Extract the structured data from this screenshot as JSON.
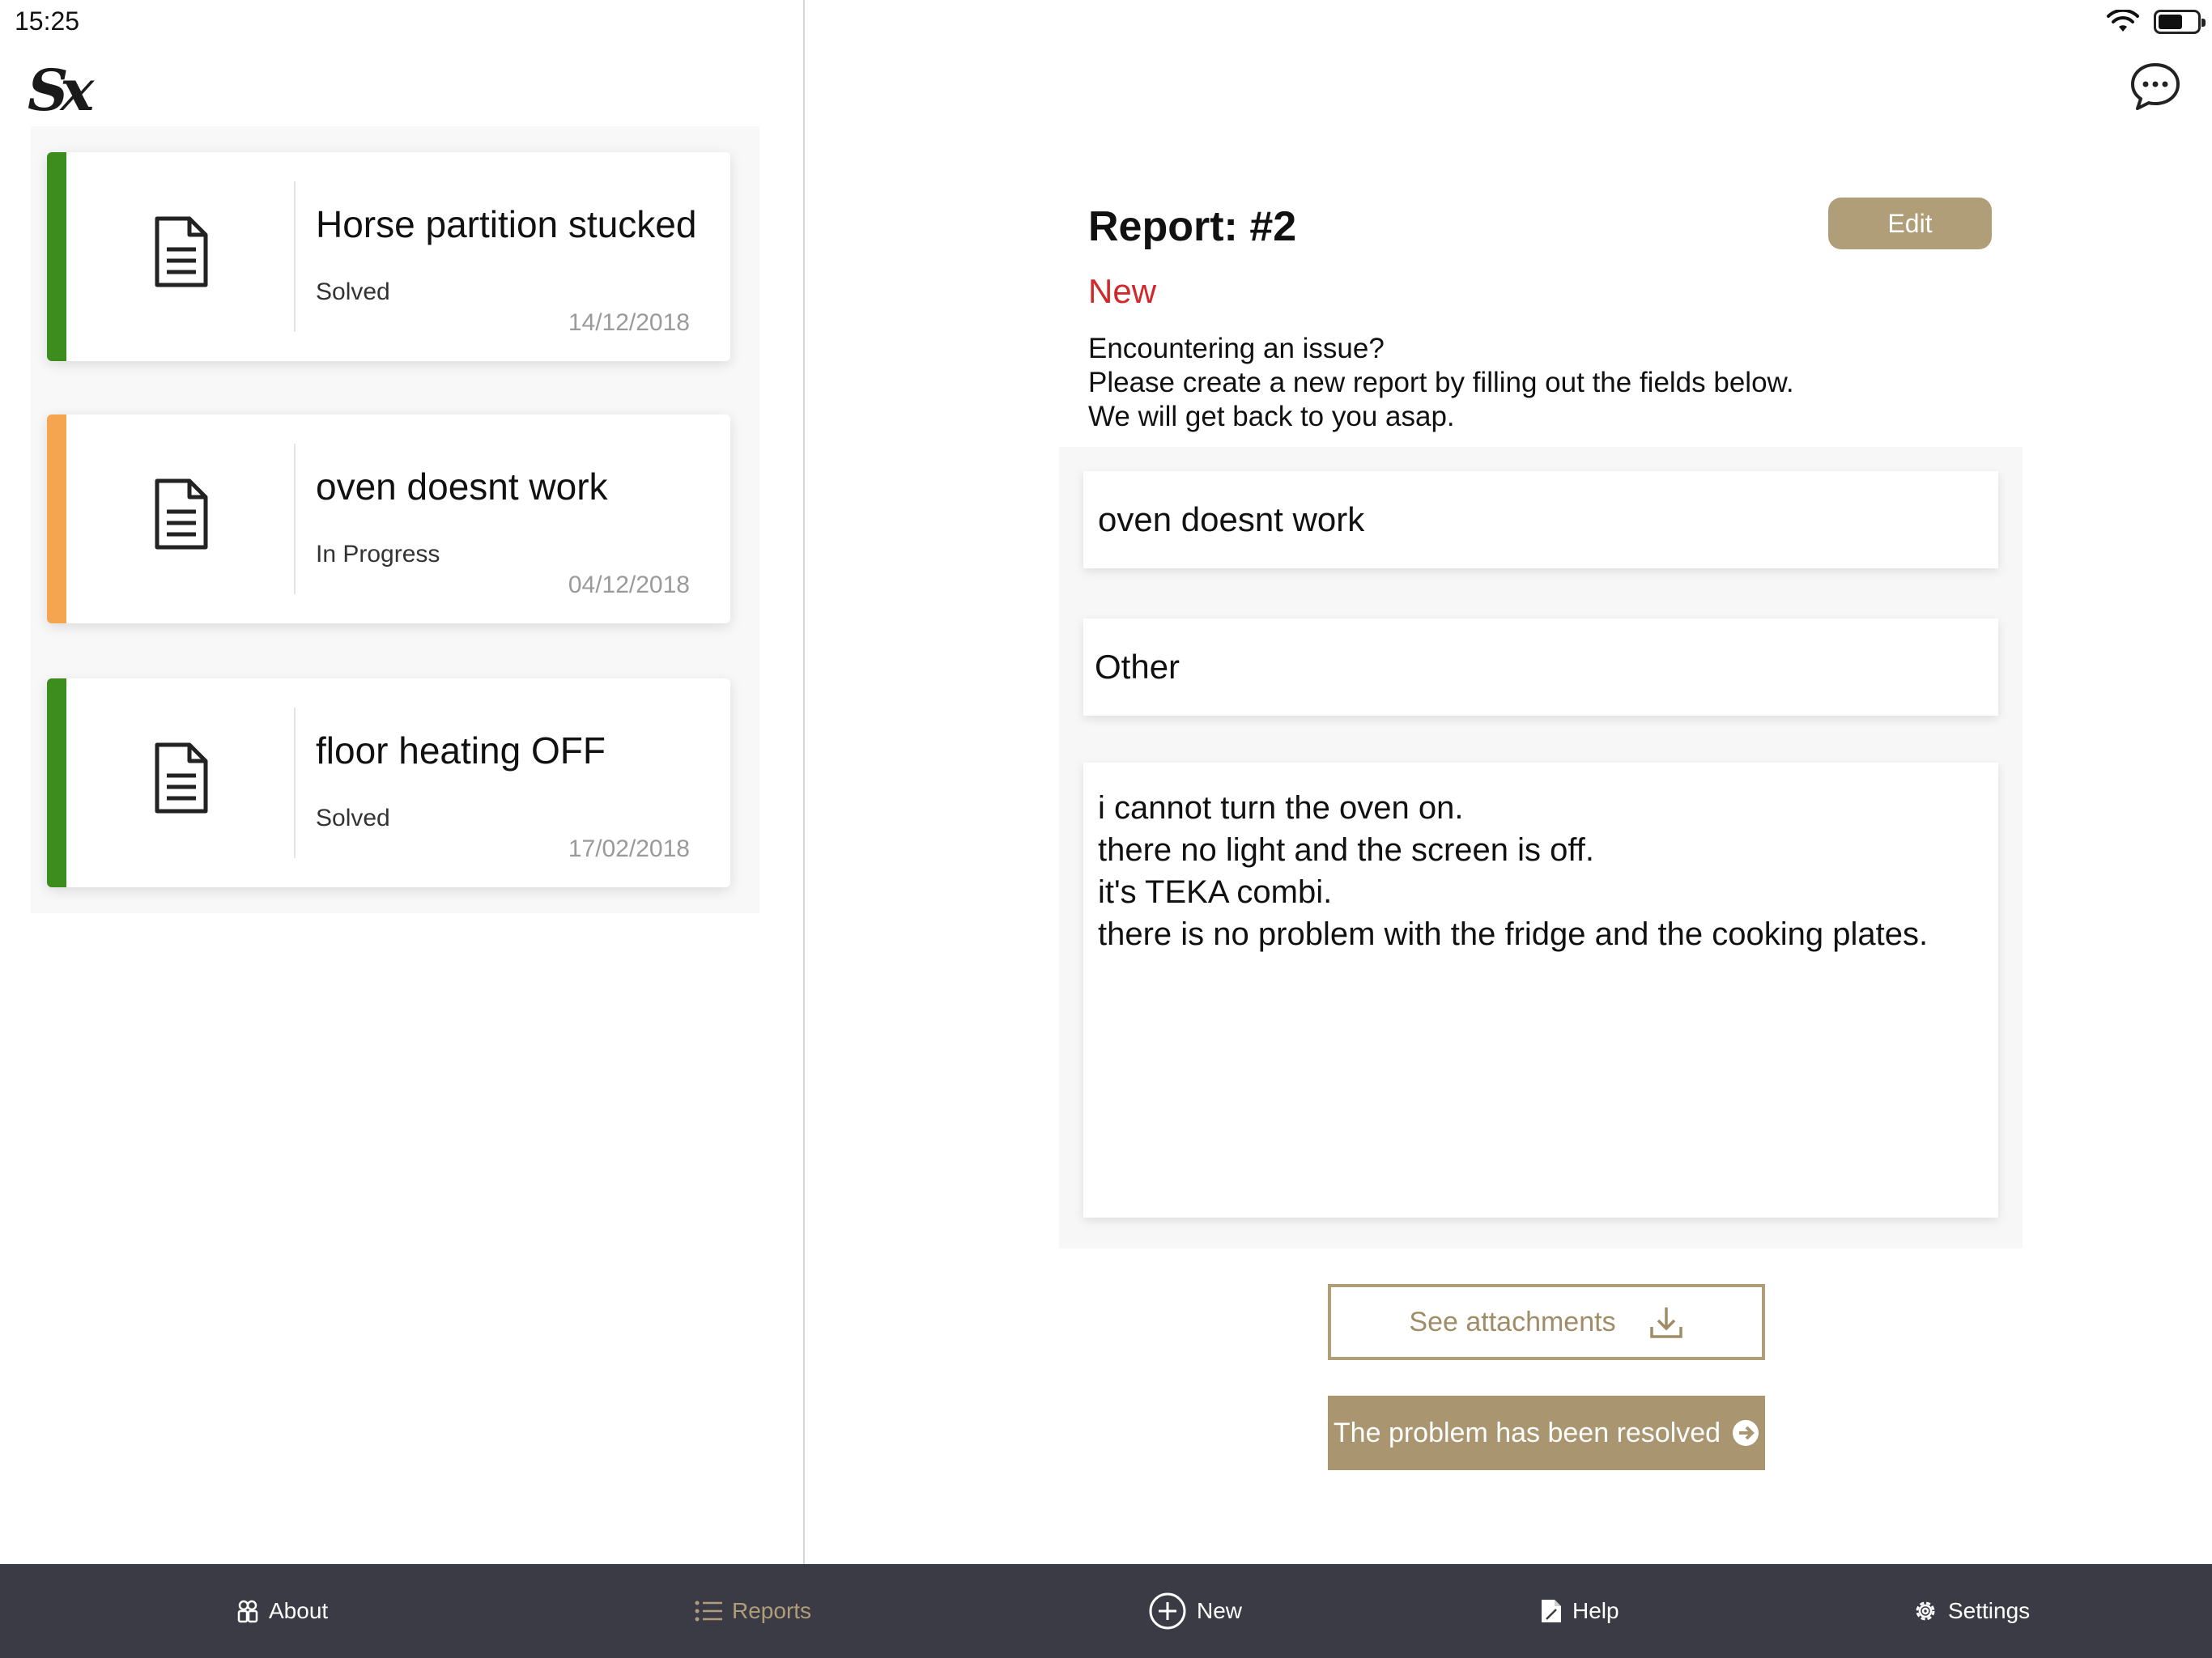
{
  "status_bar": {
    "time": "15:25"
  },
  "logo": {
    "text": "Sx"
  },
  "reports": [
    {
      "title": "Horse partition stucked",
      "status": "Solved",
      "date": "14/12/2018",
      "color": "#3c8c1e"
    },
    {
      "title": "oven doesnt work",
      "status": "In Progress",
      "date": "04/12/2018",
      "color": "#f5a450"
    },
    {
      "title": "floor heating OFF",
      "status": "Solved",
      "date": "17/02/2018",
      "color": "#3c8c1e"
    }
  ],
  "detail": {
    "heading": "Report: #2",
    "status": "New",
    "status_color": "#d0282b",
    "edit_label": "Edit",
    "intro_line1": "Encountering an issue?",
    "intro_line2": "Please create a new report by filling out the fields below.",
    "intro_line3": "We will get back to you asap.",
    "title_value": "oven doesnt work",
    "category_value": "Other",
    "description_value": "i cannot turn the oven on.\nthere no light and the screen is off.\nit's TEKA combi.\nthere is no problem with the fridge and the cooking plates.",
    "attachments_label": "See attachments",
    "resolve_label": "The problem has been resolved"
  },
  "tabs": [
    {
      "label": "About",
      "icon": "about-icon"
    },
    {
      "label": "Reports",
      "icon": "list-icon",
      "active": true
    },
    {
      "label": "New",
      "icon": "plus-circle-icon"
    },
    {
      "label": "Help",
      "icon": "help-document-icon"
    },
    {
      "label": "Settings",
      "icon": "gear-icon"
    }
  ],
  "colors": {
    "accent": "#b09e78",
    "tab_bar": "#3a3b45",
    "solved": "#3c8c1e",
    "in_progress": "#f5a450"
  }
}
